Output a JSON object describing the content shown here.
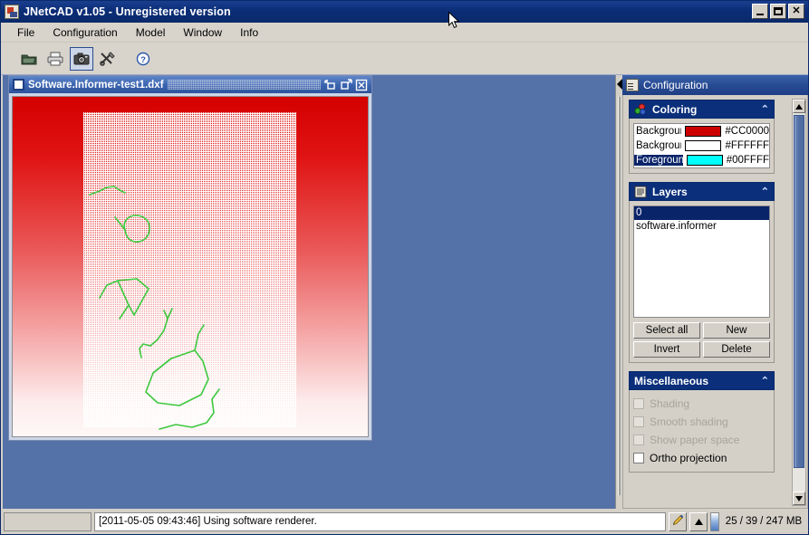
{
  "window": {
    "title": "JNetCAD v1.05 - Unregistered version",
    "icon": "app-icon",
    "controls": [
      {
        "name": "minimize",
        "label": "_"
      },
      {
        "name": "maximize",
        "label": "□"
      },
      {
        "name": "close",
        "label": "✕"
      }
    ]
  },
  "menu": {
    "items": [
      "File",
      "Configuration",
      "Model",
      "Window",
      "Info"
    ]
  },
  "toolbar": {
    "buttons": [
      {
        "name": "open-folder-icon",
        "tooltip": "Open",
        "active": false
      },
      {
        "name": "print-icon",
        "tooltip": "Print",
        "active": false
      },
      {
        "name": "camera-icon",
        "tooltip": "Snapshot",
        "active": true
      },
      {
        "name": "tools-icon",
        "tooltip": "Tools",
        "active": false
      },
      {
        "name": "help-icon",
        "tooltip": "Help",
        "active": false
      }
    ]
  },
  "child_window": {
    "title": "Software.Informer-test1.dxf",
    "buttons": [
      {
        "name": "restore",
        "label": "◱"
      },
      {
        "name": "maximize",
        "label": "◲"
      },
      {
        "name": "close",
        "label": "⊠"
      }
    ]
  },
  "canvas": {
    "background_top": "#CC0000",
    "background_bottom": "#FFFFFF",
    "foreground": "#00FFFF",
    "entity_color": "#44CC44"
  },
  "dock": {
    "title": "Configuration",
    "collapse_arrow": "◀",
    "panels": {
      "coloring": {
        "title": "Coloring",
        "chevron": "⌃",
        "rows": [
          {
            "label": "Background",
            "hex": "#CC0000",
            "selected": false
          },
          {
            "label": "Background",
            "hex": "#FFFFFF",
            "selected": false
          },
          {
            "label": "Foreground",
            "hex": "#00FFFF",
            "selected": true
          }
        ]
      },
      "layers": {
        "title": "Layers",
        "chevron": "⌃",
        "items": [
          {
            "label": "0",
            "selected": true
          },
          {
            "label": "software.informer",
            "selected": false
          }
        ],
        "buttons": [
          "Select all",
          "New",
          "Invert",
          "Delete"
        ]
      },
      "miscellaneous": {
        "title": "Miscellaneous",
        "chevron": "⌃",
        "checkboxes": [
          {
            "label": "Shading",
            "checked": false,
            "disabled": true
          },
          {
            "label": "Smooth shading",
            "checked": false,
            "disabled": true
          },
          {
            "label": "Show paper space",
            "checked": false,
            "disabled": true
          },
          {
            "label": "Ortho projection",
            "checked": false,
            "disabled": false
          }
        ]
      }
    }
  },
  "statusbar": {
    "message": "[2011-05-05 09:43:46] Using software renderer.",
    "pen_icon": "pen-icon",
    "expand_icon": "▲",
    "memory": "25 / 39 / 247 MB"
  }
}
